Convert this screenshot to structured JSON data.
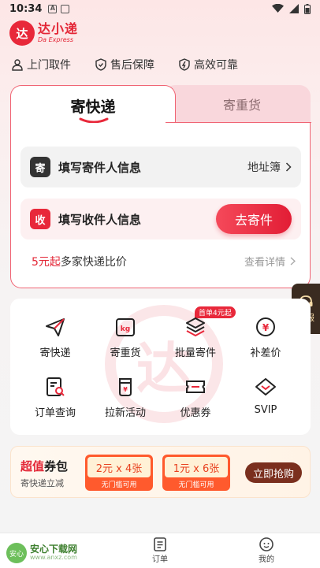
{
  "status_bar": {
    "time": "10:34",
    "icon_a": "A"
  },
  "brand": {
    "logo_char": "达",
    "name": "达小递",
    "sub": "Da Express"
  },
  "features": [
    {
      "icon": "person-icon",
      "label": "上门取件"
    },
    {
      "icon": "shield-icon",
      "label": "售后保障"
    },
    {
      "icon": "lightning-icon",
      "label": "高效可靠"
    }
  ],
  "tabs": {
    "active": "寄快递",
    "inactive": "寄重货"
  },
  "sender": {
    "badge": "寄",
    "label": "填写寄件人信息",
    "action": "地址簿"
  },
  "receiver": {
    "badge": "收",
    "label": "填写收件人信息",
    "button": "去寄件"
  },
  "compare": {
    "price": "5元起",
    "text": "多家快递比价",
    "link": "查看详情"
  },
  "float_service": {
    "label": "客服"
  },
  "grid": {
    "watermark": "达",
    "hot_tag": "首单4元起",
    "items": [
      {
        "icon": "paper-plane-icon",
        "label": "寄快递"
      },
      {
        "icon": "kg-box-icon",
        "label": "寄重货"
      },
      {
        "icon": "stack-icon",
        "label": "批量寄件"
      },
      {
        "icon": "yen-circle-icon",
        "label": "补差价"
      },
      {
        "icon": "order-search-icon",
        "label": "订单查询"
      },
      {
        "icon": "cup-icon",
        "label": "拉新活动"
      },
      {
        "icon": "ticket-icon",
        "label": "优惠券"
      },
      {
        "icon": "diamond-icon",
        "label": "SVIP"
      }
    ]
  },
  "promo": {
    "title_red": "超值",
    "title_rest": "券包",
    "subtitle": "寄快递立减",
    "coupons": [
      {
        "value": "2元 x 4张",
        "note": "无门槛可用"
      },
      {
        "value": "1元 x 6张",
        "note": "无门槛可用"
      }
    ],
    "button": "立即抢购"
  },
  "bottom_nav": {
    "watermark_logo": "安心",
    "watermark_name": "安心下载网",
    "watermark_url": "www.anxz.com",
    "orders": "订单",
    "mine": "我的"
  },
  "colors": {
    "accent": "#e8283a",
    "tab_inactive_bg": "#f9d7dc",
    "float_bg": "#3a2b20"
  }
}
